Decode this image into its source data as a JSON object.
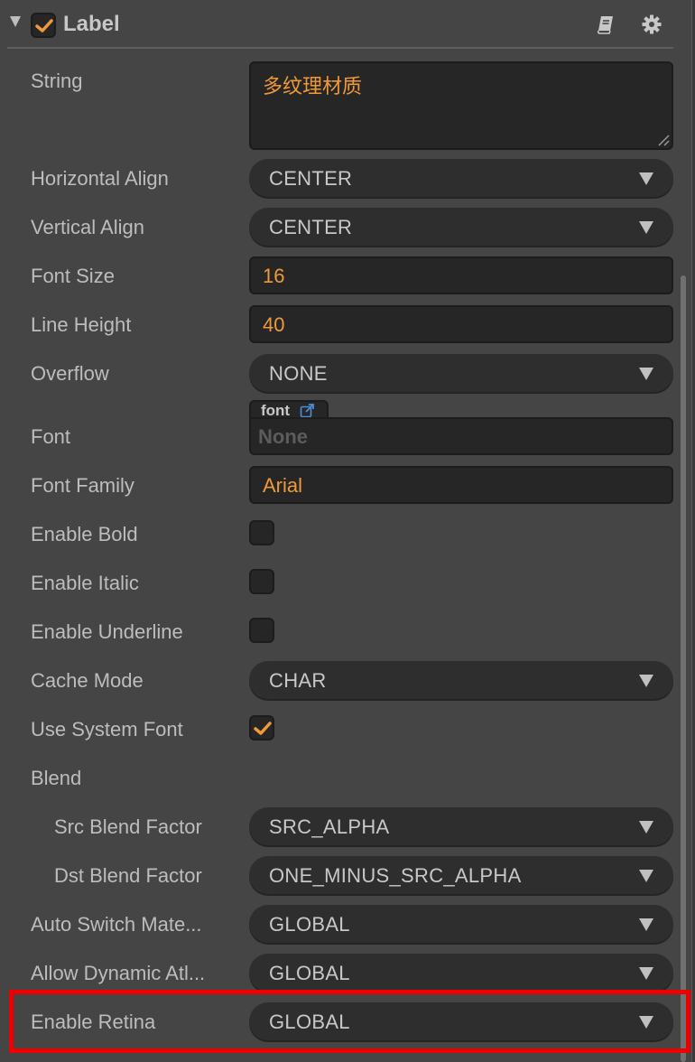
{
  "component": {
    "title": "Label",
    "enabled": true,
    "icons": {
      "collapse": "caret-down-icon",
      "docs": "book-icon",
      "settings": "gear-icon"
    }
  },
  "properties": {
    "string": {
      "label": "String",
      "value": "多纹理材质"
    },
    "horizontal_align": {
      "label": "Horizontal Align",
      "value": "CENTER"
    },
    "vertical_align": {
      "label": "Vertical Align",
      "value": "CENTER"
    },
    "font_size": {
      "label": "Font Size",
      "value": "16"
    },
    "line_height": {
      "label": "Line Height",
      "value": "40"
    },
    "overflow": {
      "label": "Overflow",
      "value": "NONE"
    },
    "font": {
      "label": "Font",
      "asset_type": "font",
      "value": "None"
    },
    "font_family": {
      "label": "Font Family",
      "value": "Arial"
    },
    "enable_bold": {
      "label": "Enable Bold",
      "checked": false
    },
    "enable_italic": {
      "label": "Enable Italic",
      "checked": false
    },
    "enable_underline": {
      "label": "Enable Underline",
      "checked": false
    },
    "cache_mode": {
      "label": "Cache Mode",
      "value": "CHAR"
    },
    "use_system_font": {
      "label": "Use System Font",
      "checked": true
    },
    "blend": {
      "label": "Blend"
    },
    "src_blend_factor": {
      "label": "Src Blend Factor",
      "value": "SRC_ALPHA"
    },
    "dst_blend_factor": {
      "label": "Dst Blend Factor",
      "value": "ONE_MINUS_SRC_ALPHA"
    },
    "auto_switch_material": {
      "label": "Auto Switch Mate...",
      "value": "GLOBAL"
    },
    "allow_dynamic_atlas": {
      "label": "Allow Dynamic Atl...",
      "value": "GLOBAL"
    },
    "enable_retina": {
      "label": "Enable Retina",
      "value": "GLOBAL",
      "highlighted": true
    }
  },
  "colors": {
    "accent": "#f0993a",
    "highlight": "#ee0000",
    "link": "#4a8fd6"
  }
}
